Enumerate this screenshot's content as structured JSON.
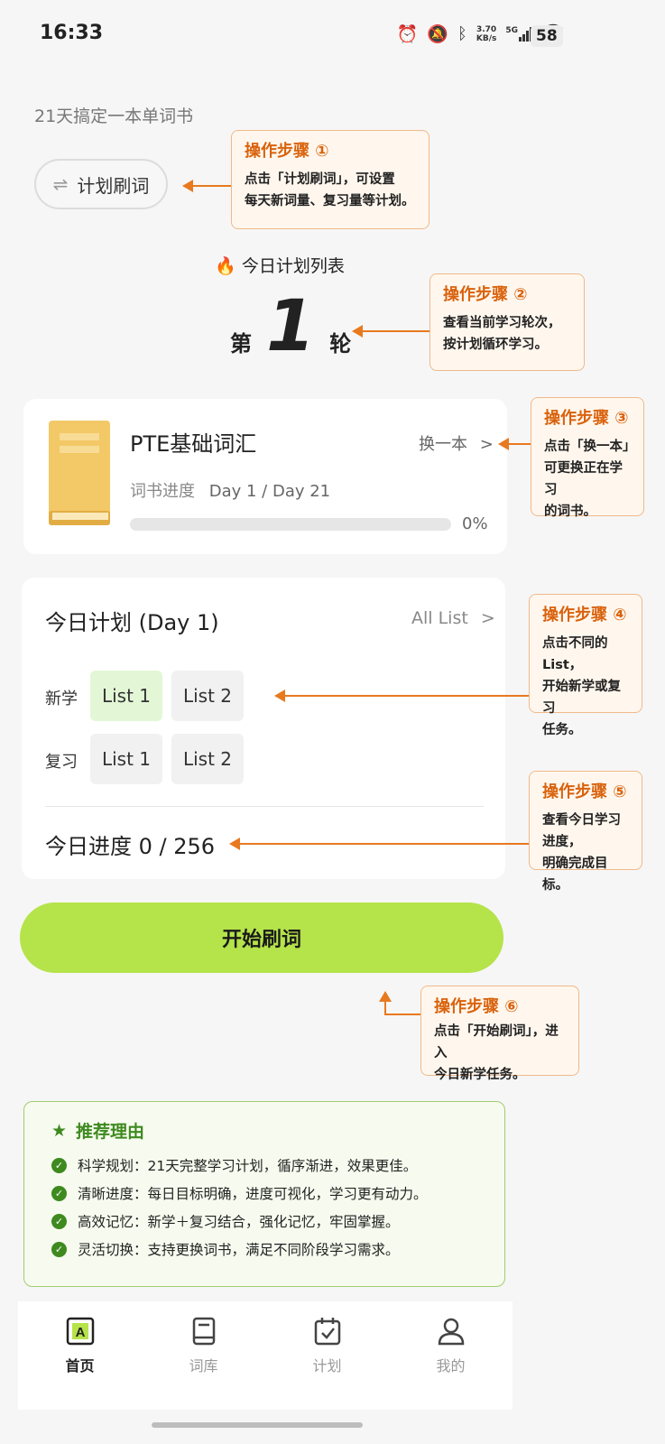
{
  "status_bar": {
    "time": "16:33",
    "speed_value": "3.70",
    "speed_unit": "KB/s",
    "network": "5G",
    "battery": "58"
  },
  "subtitle": "21天搞定一本单词书",
  "plan_button": {
    "label": "计划刷词"
  },
  "today_list_title": "今日计划列表",
  "round": {
    "prefix": "第",
    "number": "1",
    "suffix": "轮"
  },
  "book": {
    "title": "PTE基础词汇",
    "progress_label": "词书进度",
    "progress_days": "Day 1 / Day 21",
    "switch_label": "换一本",
    "percent": "0%",
    "progress_fraction": 0
  },
  "plan": {
    "title": "今日计划 (Day 1)",
    "all_list": "All List",
    "new_label": "新学",
    "review_label": "复习",
    "new_lists": [
      "List 1",
      "List 2"
    ],
    "review_lists": [
      "List 1",
      "List 2"
    ],
    "today_progress": "今日进度 0 / 256"
  },
  "start_button": "开始刷词",
  "callouts": [
    {
      "title": "操作步骤 ①",
      "lines": [
        "点击「计划刷词」，可设置",
        "每天新词量、复习量等计划。"
      ]
    },
    {
      "title": "操作步骤 ②",
      "lines": [
        "查看当前学习轮次，",
        "按计划循环学习。"
      ]
    },
    {
      "title": "操作步骤 ③",
      "lines": [
        "点击「换一本」",
        "可更换正在学习",
        "的词书。"
      ]
    },
    {
      "title": "操作步骤 ④",
      "lines": [
        "点击不同的 List，",
        "开始新学或复习",
        "任务。"
      ]
    },
    {
      "title": "操作步骤 ⑤",
      "lines": [
        "查看今日学习进度，",
        "明确完成目标。"
      ]
    },
    {
      "title": "操作步骤 ⑥",
      "lines": [
        "点击「开始刷词」，进入",
        "今日新学任务。"
      ]
    }
  ],
  "reasons": {
    "title": "推荐理由",
    "items": [
      "科学规划：21天完整学习计划，循序渐进，效果更佳。",
      "清晰进度：每日目标明确，进度可视化，学习更有动力。",
      "高效记忆：新学＋复习结合，强化记忆，牢固掌握。",
      "灵活切换：支持更换词书，满足不同阶段学习需求。"
    ]
  },
  "tabs": [
    {
      "label": "首页",
      "icon": "home-a-icon"
    },
    {
      "label": "词库",
      "icon": "book-icon"
    },
    {
      "label": "计划",
      "icon": "calendar-check-icon"
    },
    {
      "label": "我的",
      "icon": "user-icon"
    }
  ],
  "colors": {
    "accent_green": "#b5e34a",
    "callout_orange": "#e8791f",
    "reason_green": "#3e8a1f"
  }
}
